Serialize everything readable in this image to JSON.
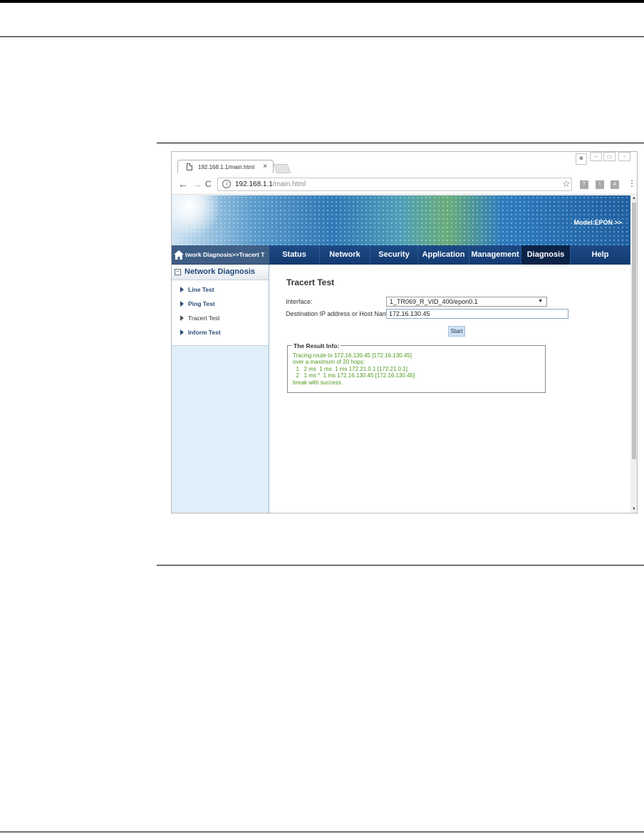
{
  "browser": {
    "tab_title": "192.168.1.1/main.html",
    "tab_close": "×",
    "url_host": "192.168.1.1",
    "url_path": "/main.html",
    "back": "←",
    "forward": "→",
    "reload": "C",
    "info": "i",
    "star": "☆",
    "ext1": "T",
    "ext2": "I",
    "ext3": "A",
    "menu": "⋮",
    "win_min": "–",
    "win_max": "▭",
    "win_close": "▫"
  },
  "banner": {
    "model": "Model:EPON  >>"
  },
  "breadcrumb": "twork Diagnosis>>Tracert T",
  "nav": [
    {
      "label": "Status"
    },
    {
      "label": "Network"
    },
    {
      "label": "Security"
    },
    {
      "label": "Application"
    },
    {
      "label": "Management"
    },
    {
      "label": "Diagnosis",
      "active": true
    },
    {
      "label": "Help"
    }
  ],
  "sidebar": {
    "title": "Network Diagnosis",
    "toggle": "−",
    "items": [
      {
        "label": "Line Test"
      },
      {
        "label": "Ping Test"
      },
      {
        "label": "Tracert Test",
        "current": true
      },
      {
        "label": "Inform Test"
      }
    ]
  },
  "content": {
    "title": "Tracert Test",
    "interface_label": "Interface:",
    "interface_value": "1_TR069_R_VID_400/epon0.1",
    "dest_label": "Destination IP address or Host Name:",
    "dest_value": "172.16.130.45",
    "start_label": "Start",
    "result_legend": "The Result Info:",
    "result_lines": [
      "Tracing route to 172.16.130.45 [172.16.130.45]",
      "over a maximum of 20 hops:",
      "  1   2 ms  1 ms  1 ms 172.21.0.1 [172.21.0.1]",
      "  2   1 ms *  1 ms 172.16.130.45 [172.16.130.45]",
      "break with success."
    ]
  },
  "colors": {
    "nav_bg": "#1d4a86",
    "nav_active": "#0b2347",
    "sidebar_bg": "#dfeef8",
    "result_text": "#4f9a1f"
  }
}
